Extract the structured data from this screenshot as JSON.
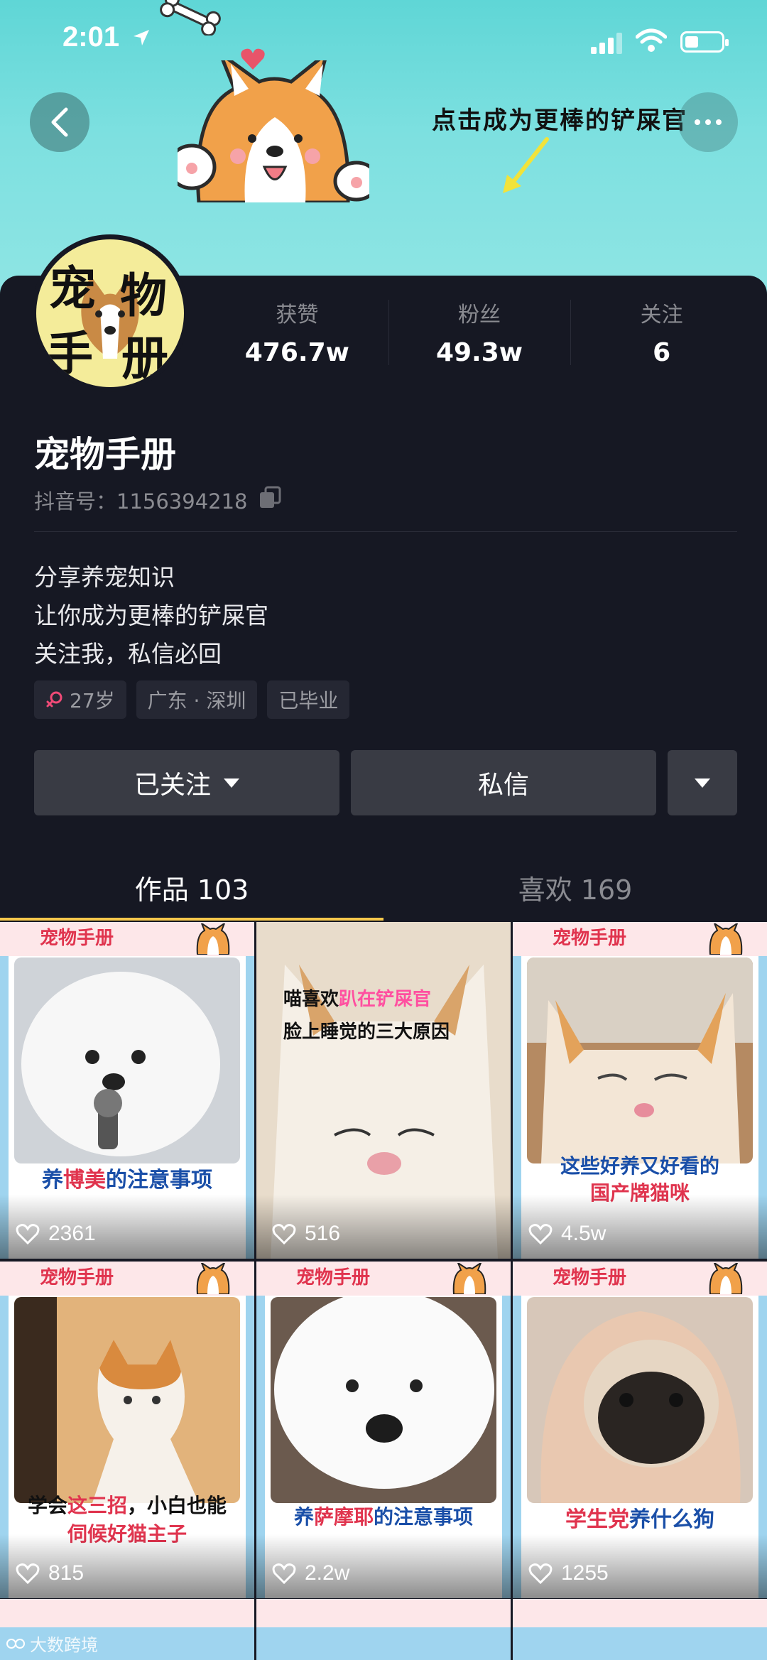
{
  "status_bar": {
    "time": "2:01"
  },
  "banner": {
    "text": "点击成为更棒的铲屎官"
  },
  "avatar": {
    "chars": [
      "宠",
      "物",
      "手",
      "册"
    ]
  },
  "stats": [
    {
      "label": "获赞",
      "value": "476.7w"
    },
    {
      "label": "粉丝",
      "value": "49.3w"
    },
    {
      "label": "关注",
      "value": "6"
    }
  ],
  "profile": {
    "name": "宠物手册",
    "douyin_id": "抖音号：1156394218",
    "bio": [
      "分享养宠知识",
      "让你成为更棒的铲屎官",
      "关注我，私信必回"
    ],
    "tags": [
      "27岁",
      "广东 · 深圳",
      "已毕业"
    ]
  },
  "actions": {
    "follow": "已关注",
    "message": "私信"
  },
  "tabs": [
    {
      "label": "作品 103",
      "active": true
    },
    {
      "label": "喜欢 169",
      "active": false
    }
  ],
  "videos": [
    {
      "brand": "宠物手册",
      "caption_pre": "养",
      "caption_hl": "博美",
      "caption_post": "的注意事项",
      "caption2": "",
      "likes": "2361",
      "theme": "pom"
    },
    {
      "brand": "",
      "caption_pre": "喵喜欢",
      "caption_hl": "趴在铲屎官",
      "caption_post": "",
      "caption2": "脸上睡觉的三大原因",
      "likes": "516",
      "theme": "cat1"
    },
    {
      "brand": "宠物手册",
      "caption_pre": "这些好养又好看的",
      "caption_hl": "",
      "caption_post": "",
      "caption2": "国产牌猫咪",
      "likes": "4.5w",
      "theme": "cat2"
    },
    {
      "brand": "宠物手册",
      "caption_pre": "学会",
      "caption_hl": "这三招",
      "caption_post": "，小白也能",
      "caption2": "伺候好猫主子",
      "likes": "815",
      "theme": "cat3"
    },
    {
      "brand": "宠物手册",
      "caption_pre": "养",
      "caption_hl": "萨摩耶",
      "caption_post": "的注意事项",
      "caption2": "",
      "likes": "2.2w",
      "theme": "samoyed"
    },
    {
      "brand": "宠物手册",
      "caption_pre": "",
      "caption_hl": "学生党",
      "caption_post": "养什么狗",
      "caption2": "",
      "likes": "1255",
      "theme": "pug"
    }
  ],
  "watermark": "大数跨境"
}
